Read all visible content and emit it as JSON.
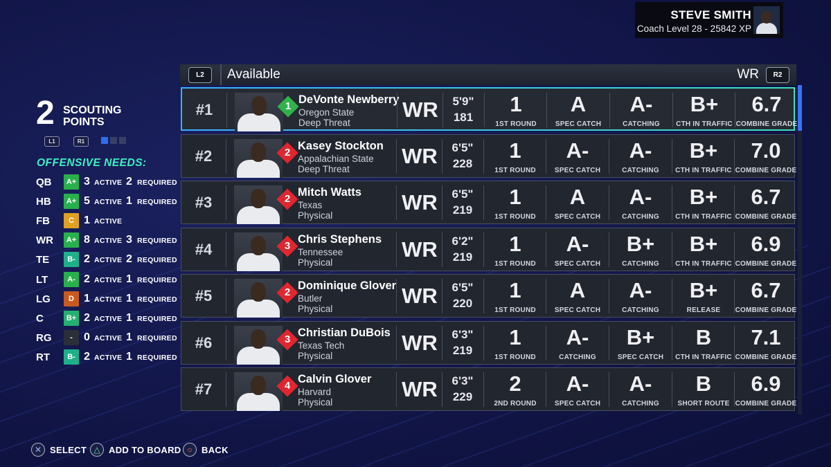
{
  "coach": {
    "name": "STEVE SMITH",
    "level": "Coach Level 28 - 25842 XP"
  },
  "scouting": {
    "points": "2",
    "label_line1": "SCOUTING",
    "label_line2": "POINTS",
    "l1": "L1",
    "r1": "R1"
  },
  "needs": {
    "title": "OFFENSIVE NEEDS:",
    "active_label": "ACTIVE",
    "required_label": "REQUIRED",
    "rows": [
      {
        "pos": "QB",
        "grade": "A+",
        "color": "#27b04b",
        "active": "3",
        "required": "2"
      },
      {
        "pos": "HB",
        "grade": "A+",
        "color": "#27b04b",
        "active": "5",
        "required": "1"
      },
      {
        "pos": "FB",
        "grade": "C",
        "color": "#e0a020",
        "active": "1",
        "required": ""
      },
      {
        "pos": "WR",
        "grade": "A+",
        "color": "#27b04b",
        "active": "8",
        "required": "3"
      },
      {
        "pos": "TE",
        "grade": "B-",
        "color": "#1fb089",
        "active": "2",
        "required": "2"
      },
      {
        "pos": "LT",
        "grade": "A-",
        "color": "#27b04b",
        "active": "2",
        "required": "1"
      },
      {
        "pos": "LG",
        "grade": "D",
        "color": "#c85a20",
        "active": "1",
        "required": "1"
      },
      {
        "pos": "C",
        "grade": "B+",
        "color": "#23b070",
        "active": "2",
        "required": "1"
      },
      {
        "pos": "RG",
        "grade": "-",
        "color": "#2a2f3a",
        "active": "0",
        "required": "1"
      },
      {
        "pos": "RT",
        "grade": "B-",
        "color": "#1fb089",
        "active": "2",
        "required": "1"
      }
    ]
  },
  "header": {
    "l2": "L2",
    "r2": "R2",
    "title": "Available",
    "position_filter": "WR"
  },
  "prospects": [
    {
      "rank": "#1",
      "name": "DeVonte Newberry",
      "school": "Oregon State",
      "archetype": "Deep Threat",
      "tier": "1",
      "tier_color": "#2fb34a",
      "pos": "WR",
      "height": "5'9\"",
      "weight": "181",
      "stats": [
        {
          "v": "1",
          "l": "1ST ROUND"
        },
        {
          "v": "A",
          "l": "SPEC CATCH"
        },
        {
          "v": "A-",
          "l": "CATCHING"
        },
        {
          "v": "B+",
          "l": "CTH IN TRAFFIC"
        },
        {
          "v": "6.7",
          "l": "COMBINE GRADE"
        }
      ]
    },
    {
      "rank": "#2",
      "name": "Kasey Stockton",
      "school": "Appalachian State",
      "archetype": "Deep Threat",
      "tier": "2",
      "tier_color": "#e02630",
      "pos": "WR",
      "height": "6'5\"",
      "weight": "228",
      "stats": [
        {
          "v": "1",
          "l": "1ST ROUND"
        },
        {
          "v": "A-",
          "l": "SPEC CATCH"
        },
        {
          "v": "A-",
          "l": "CATCHING"
        },
        {
          "v": "B+",
          "l": "CTH IN TRAFFIC"
        },
        {
          "v": "7.0",
          "l": "COMBINE GRADE"
        }
      ]
    },
    {
      "rank": "#3",
      "name": "Mitch Watts",
      "school": "Texas",
      "archetype": "Physical",
      "tier": "2",
      "tier_color": "#e02630",
      "pos": "WR",
      "height": "6'5\"",
      "weight": "219",
      "stats": [
        {
          "v": "1",
          "l": "1ST ROUND"
        },
        {
          "v": "A",
          "l": "SPEC CATCH"
        },
        {
          "v": "A-",
          "l": "CATCHING"
        },
        {
          "v": "B+",
          "l": "CTH IN TRAFFIC"
        },
        {
          "v": "6.7",
          "l": "COMBINE GRADE"
        }
      ]
    },
    {
      "rank": "#4",
      "name": "Chris Stephens",
      "school": "Tennessee",
      "archetype": "Physical",
      "tier": "3",
      "tier_color": "#e02630",
      "pos": "WR",
      "height": "6'2\"",
      "weight": "219",
      "stats": [
        {
          "v": "1",
          "l": "1ST ROUND"
        },
        {
          "v": "A-",
          "l": "SPEC CATCH"
        },
        {
          "v": "B+",
          "l": "CATCHING"
        },
        {
          "v": "B+",
          "l": "CTH IN TRAFFIC"
        },
        {
          "v": "6.9",
          "l": "COMBINE GRADE"
        }
      ]
    },
    {
      "rank": "#5",
      "name": "Dominique Glover",
      "school": "Butler",
      "archetype": "Physical",
      "tier": "2",
      "tier_color": "#e02630",
      "pos": "WR",
      "height": "6'5\"",
      "weight": "220",
      "stats": [
        {
          "v": "1",
          "l": "1ST ROUND"
        },
        {
          "v": "A",
          "l": "SPEC CATCH"
        },
        {
          "v": "A-",
          "l": "CATCHING"
        },
        {
          "v": "B+",
          "l": "RELEASE"
        },
        {
          "v": "6.7",
          "l": "COMBINE GRADE"
        }
      ]
    },
    {
      "rank": "#6",
      "name": "Christian DuBois",
      "school": "Texas Tech",
      "archetype": "Physical",
      "tier": "3",
      "tier_color": "#e02630",
      "pos": "WR",
      "height": "6'3\"",
      "weight": "219",
      "stats": [
        {
          "v": "1",
          "l": "1ST ROUND"
        },
        {
          "v": "A-",
          "l": "CATCHING"
        },
        {
          "v": "B+",
          "l": "SPEC CATCH"
        },
        {
          "v": "B",
          "l": "CTH IN TRAFFIC"
        },
        {
          "v": "7.1",
          "l": "COMBINE GRADE"
        }
      ]
    },
    {
      "rank": "#7",
      "name": "Calvin Glover",
      "school": "Harvard",
      "archetype": "Physical",
      "tier": "4",
      "tier_color": "#e02630",
      "pos": "WR",
      "height": "6'3\"",
      "weight": "229",
      "stats": [
        {
          "v": "2",
          "l": "2ND ROUND"
        },
        {
          "v": "A-",
          "l": "SPEC CATCH"
        },
        {
          "v": "A-",
          "l": "CATCHING"
        },
        {
          "v": "B",
          "l": "SHORT ROUTE"
        },
        {
          "v": "6.9",
          "l": "COMBINE GRADE"
        }
      ]
    }
  ],
  "footer": {
    "select": "SELECT",
    "add": "ADD TO BOARD",
    "back": "BACK"
  }
}
